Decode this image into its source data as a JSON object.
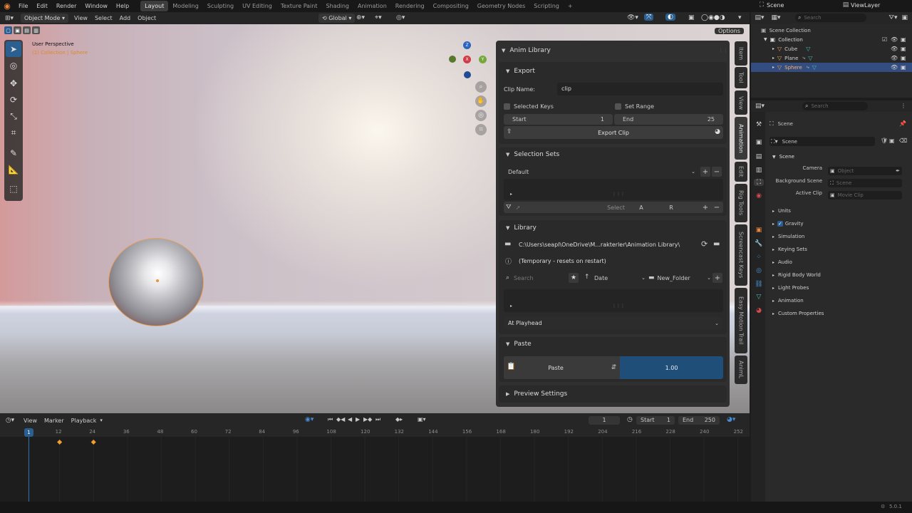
{
  "topbar": {
    "menus": [
      "File",
      "Edit",
      "Render",
      "Window",
      "Help"
    ],
    "workspaces": [
      "Layout",
      "Modeling",
      "Sculpting",
      "UV Editing",
      "Texture Paint",
      "Shading",
      "Animation",
      "Rendering",
      "Compositing",
      "Geometry Nodes",
      "Scripting"
    ],
    "add_tab": "+",
    "scene": "Scene",
    "view_layer": "ViewLayer"
  },
  "viewport_header": {
    "mode": "Object Mode",
    "menus": [
      "View",
      "Select",
      "Add",
      "Object"
    ],
    "transform": "Global",
    "options": "Options"
  },
  "viewport": {
    "title": "User Perspective",
    "subtitle": "(1) Collection | Sphere"
  },
  "gizmo": {
    "z": "Z",
    "x": "X",
    "y": "Y"
  },
  "sidebar_tabs": [
    "Item",
    "Tool",
    "View",
    "Animation",
    "Edit",
    "Rig Tools",
    "Screencast Keys",
    "Easy Motion Trail",
    "AnimL"
  ],
  "anim_library": {
    "title": "Anim Library",
    "export": {
      "title": "Export",
      "clip_name_label": "Clip Name:",
      "clip_name": "clip",
      "selected_keys": "Selected Keys",
      "set_range": "Set Range",
      "start_label": "Start",
      "start_value": "1",
      "end_label": "End",
      "end_value": "25",
      "export_button": "Export Clip"
    },
    "selection_sets": {
      "title": "Selection Sets",
      "current": "Default",
      "select_button": "Select",
      "a_button": "A",
      "r_button": "R"
    },
    "library": {
      "title": "Library",
      "path": "C:\\Users\\seapl\\OneDrive\\M...rakterler\\Animation Library\\",
      "temp_note": "(Temporary - resets on restart)",
      "search_placeholder": "Search",
      "sort": "Date",
      "folder": "New_Folder",
      "placement": "At Playhead"
    },
    "paste": {
      "title": "Paste",
      "paste_button": "Paste",
      "factor": "1.00"
    },
    "preview": {
      "title": "Preview Settings"
    }
  },
  "timeline": {
    "menus": [
      "View",
      "Marker",
      "Playback"
    ],
    "current_frame": "1",
    "start_label": "Start",
    "start": "1",
    "end_label": "End",
    "end": "250",
    "ruler": [
      "1",
      "12",
      "24",
      "36",
      "48",
      "60",
      "72",
      "84",
      "96",
      "108",
      "120",
      "132",
      "144",
      "156",
      "168",
      "180",
      "192",
      "204",
      "216",
      "228",
      "240",
      "252"
    ],
    "keyframes": [
      12,
      24
    ]
  },
  "outliner": {
    "search_placeholder": "Search",
    "scene_collection": "Scene Collection",
    "collection": "Collection",
    "items": [
      "Cube",
      "Plane",
      "Sphere"
    ]
  },
  "properties": {
    "search_placeholder": "Search",
    "context": "Scene",
    "scene_field": "Scene",
    "panel_title": "Scene",
    "camera_label": "Camera",
    "camera_placeholder": "Object",
    "bg_scene_label": "Background Scene",
    "bg_scene_placeholder": "Scene",
    "active_clip_label": "Active Clip",
    "active_clip_placeholder": "Movie Clip",
    "sections": [
      "Units",
      "Gravity",
      "Simulation",
      "Keying Sets",
      "Audio",
      "Rigid Body World",
      "Light Probes",
      "Animation",
      "Custom Properties"
    ]
  },
  "status": {
    "version": "5.0.1"
  },
  "colors": {
    "accent": "#2a5f8f",
    "selected_row": "#334d80",
    "active_object": "#e8a05a",
    "paste_factor": "#1f4f78"
  }
}
